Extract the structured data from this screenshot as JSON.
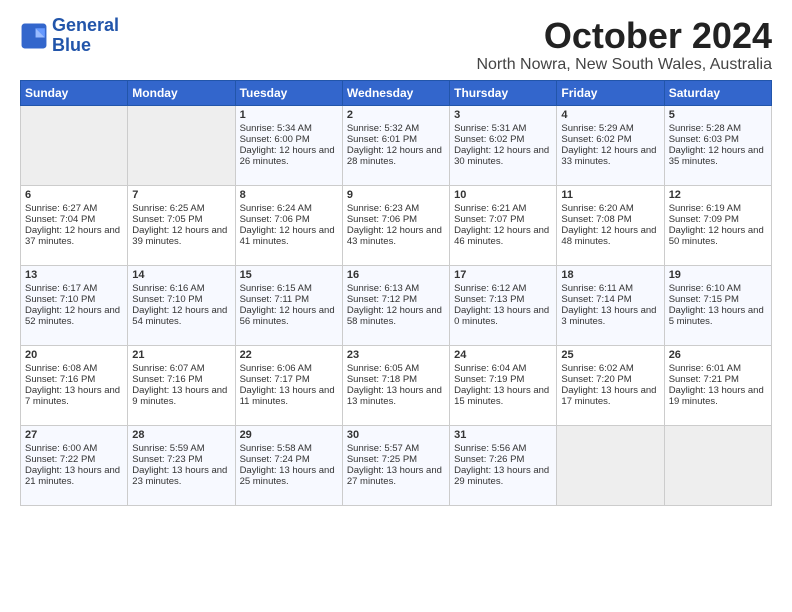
{
  "logo": {
    "line1": "General",
    "line2": "Blue"
  },
  "title": "October 2024",
  "subtitle": "North Nowra, New South Wales, Australia",
  "headers": [
    "Sunday",
    "Monday",
    "Tuesday",
    "Wednesday",
    "Thursday",
    "Friday",
    "Saturday"
  ],
  "weeks": [
    [
      {
        "day": "",
        "sunrise": "",
        "sunset": "",
        "daylight": "",
        "empty": true
      },
      {
        "day": "",
        "sunrise": "",
        "sunset": "",
        "daylight": "",
        "empty": true
      },
      {
        "day": "1",
        "sunrise": "Sunrise: 5:34 AM",
        "sunset": "Sunset: 6:00 PM",
        "daylight": "Daylight: 12 hours and 26 minutes.",
        "empty": false
      },
      {
        "day": "2",
        "sunrise": "Sunrise: 5:32 AM",
        "sunset": "Sunset: 6:01 PM",
        "daylight": "Daylight: 12 hours and 28 minutes.",
        "empty": false
      },
      {
        "day": "3",
        "sunrise": "Sunrise: 5:31 AM",
        "sunset": "Sunset: 6:02 PM",
        "daylight": "Daylight: 12 hours and 30 minutes.",
        "empty": false
      },
      {
        "day": "4",
        "sunrise": "Sunrise: 5:29 AM",
        "sunset": "Sunset: 6:02 PM",
        "daylight": "Daylight: 12 hours and 33 minutes.",
        "empty": false
      },
      {
        "day": "5",
        "sunrise": "Sunrise: 5:28 AM",
        "sunset": "Sunset: 6:03 PM",
        "daylight": "Daylight: 12 hours and 35 minutes.",
        "empty": false
      }
    ],
    [
      {
        "day": "6",
        "sunrise": "Sunrise: 6:27 AM",
        "sunset": "Sunset: 7:04 PM",
        "daylight": "Daylight: 12 hours and 37 minutes.",
        "empty": false
      },
      {
        "day": "7",
        "sunrise": "Sunrise: 6:25 AM",
        "sunset": "Sunset: 7:05 PM",
        "daylight": "Daylight: 12 hours and 39 minutes.",
        "empty": false
      },
      {
        "day": "8",
        "sunrise": "Sunrise: 6:24 AM",
        "sunset": "Sunset: 7:06 PM",
        "daylight": "Daylight: 12 hours and 41 minutes.",
        "empty": false
      },
      {
        "day": "9",
        "sunrise": "Sunrise: 6:23 AM",
        "sunset": "Sunset: 7:06 PM",
        "daylight": "Daylight: 12 hours and 43 minutes.",
        "empty": false
      },
      {
        "day": "10",
        "sunrise": "Sunrise: 6:21 AM",
        "sunset": "Sunset: 7:07 PM",
        "daylight": "Daylight: 12 hours and 46 minutes.",
        "empty": false
      },
      {
        "day": "11",
        "sunrise": "Sunrise: 6:20 AM",
        "sunset": "Sunset: 7:08 PM",
        "daylight": "Daylight: 12 hours and 48 minutes.",
        "empty": false
      },
      {
        "day": "12",
        "sunrise": "Sunrise: 6:19 AM",
        "sunset": "Sunset: 7:09 PM",
        "daylight": "Daylight: 12 hours and 50 minutes.",
        "empty": false
      }
    ],
    [
      {
        "day": "13",
        "sunrise": "Sunrise: 6:17 AM",
        "sunset": "Sunset: 7:10 PM",
        "daylight": "Daylight: 12 hours and 52 minutes.",
        "empty": false
      },
      {
        "day": "14",
        "sunrise": "Sunrise: 6:16 AM",
        "sunset": "Sunset: 7:10 PM",
        "daylight": "Daylight: 12 hours and 54 minutes.",
        "empty": false
      },
      {
        "day": "15",
        "sunrise": "Sunrise: 6:15 AM",
        "sunset": "Sunset: 7:11 PM",
        "daylight": "Daylight: 12 hours and 56 minutes.",
        "empty": false
      },
      {
        "day": "16",
        "sunrise": "Sunrise: 6:13 AM",
        "sunset": "Sunset: 7:12 PM",
        "daylight": "Daylight: 12 hours and 58 minutes.",
        "empty": false
      },
      {
        "day": "17",
        "sunrise": "Sunrise: 6:12 AM",
        "sunset": "Sunset: 7:13 PM",
        "daylight": "Daylight: 13 hours and 0 minutes.",
        "empty": false
      },
      {
        "day": "18",
        "sunrise": "Sunrise: 6:11 AM",
        "sunset": "Sunset: 7:14 PM",
        "daylight": "Daylight: 13 hours and 3 minutes.",
        "empty": false
      },
      {
        "day": "19",
        "sunrise": "Sunrise: 6:10 AM",
        "sunset": "Sunset: 7:15 PM",
        "daylight": "Daylight: 13 hours and 5 minutes.",
        "empty": false
      }
    ],
    [
      {
        "day": "20",
        "sunrise": "Sunrise: 6:08 AM",
        "sunset": "Sunset: 7:16 PM",
        "daylight": "Daylight: 13 hours and 7 minutes.",
        "empty": false
      },
      {
        "day": "21",
        "sunrise": "Sunrise: 6:07 AM",
        "sunset": "Sunset: 7:16 PM",
        "daylight": "Daylight: 13 hours and 9 minutes.",
        "empty": false
      },
      {
        "day": "22",
        "sunrise": "Sunrise: 6:06 AM",
        "sunset": "Sunset: 7:17 PM",
        "daylight": "Daylight: 13 hours and 11 minutes.",
        "empty": false
      },
      {
        "day": "23",
        "sunrise": "Sunrise: 6:05 AM",
        "sunset": "Sunset: 7:18 PM",
        "daylight": "Daylight: 13 hours and 13 minutes.",
        "empty": false
      },
      {
        "day": "24",
        "sunrise": "Sunrise: 6:04 AM",
        "sunset": "Sunset: 7:19 PM",
        "daylight": "Daylight: 13 hours and 15 minutes.",
        "empty": false
      },
      {
        "day": "25",
        "sunrise": "Sunrise: 6:02 AM",
        "sunset": "Sunset: 7:20 PM",
        "daylight": "Daylight: 13 hours and 17 minutes.",
        "empty": false
      },
      {
        "day": "26",
        "sunrise": "Sunrise: 6:01 AM",
        "sunset": "Sunset: 7:21 PM",
        "daylight": "Daylight: 13 hours and 19 minutes.",
        "empty": false
      }
    ],
    [
      {
        "day": "27",
        "sunrise": "Sunrise: 6:00 AM",
        "sunset": "Sunset: 7:22 PM",
        "daylight": "Daylight: 13 hours and 21 minutes.",
        "empty": false
      },
      {
        "day": "28",
        "sunrise": "Sunrise: 5:59 AM",
        "sunset": "Sunset: 7:23 PM",
        "daylight": "Daylight: 13 hours and 23 minutes.",
        "empty": false
      },
      {
        "day": "29",
        "sunrise": "Sunrise: 5:58 AM",
        "sunset": "Sunset: 7:24 PM",
        "daylight": "Daylight: 13 hours and 25 minutes.",
        "empty": false
      },
      {
        "day": "30",
        "sunrise": "Sunrise: 5:57 AM",
        "sunset": "Sunset: 7:25 PM",
        "daylight": "Daylight: 13 hours and 27 minutes.",
        "empty": false
      },
      {
        "day": "31",
        "sunrise": "Sunrise: 5:56 AM",
        "sunset": "Sunset: 7:26 PM",
        "daylight": "Daylight: 13 hours and 29 minutes.",
        "empty": false
      },
      {
        "day": "",
        "sunrise": "",
        "sunset": "",
        "daylight": "",
        "empty": true
      },
      {
        "day": "",
        "sunrise": "",
        "sunset": "",
        "daylight": "",
        "empty": true
      }
    ]
  ]
}
